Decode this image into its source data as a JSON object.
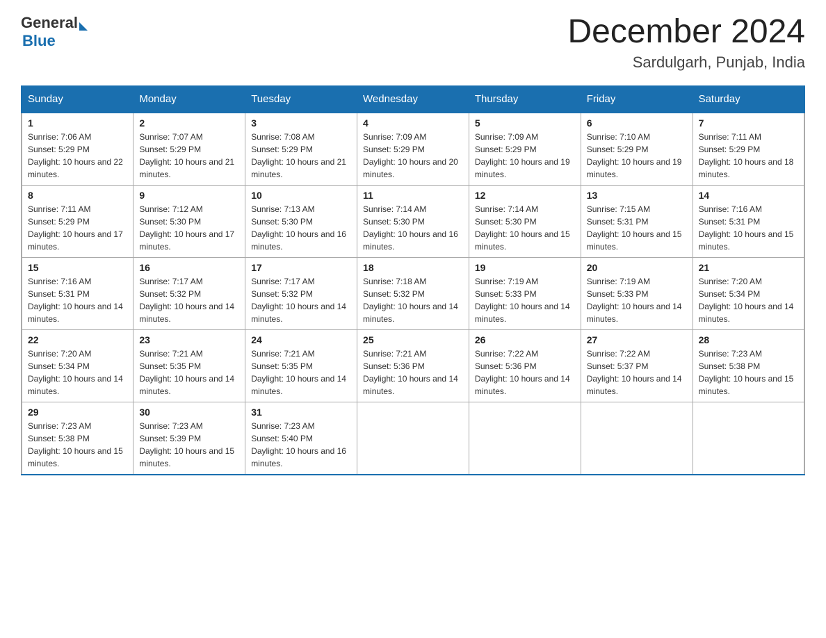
{
  "header": {
    "logo_general": "General",
    "logo_blue": "Blue",
    "title": "December 2024",
    "subtitle": "Sardulgarh, Punjab, India"
  },
  "days_of_week": [
    "Sunday",
    "Monday",
    "Tuesday",
    "Wednesday",
    "Thursday",
    "Friday",
    "Saturday"
  ],
  "weeks": [
    [
      {
        "day": "1",
        "sunrise": "7:06 AM",
        "sunset": "5:29 PM",
        "daylight": "10 hours and 22 minutes."
      },
      {
        "day": "2",
        "sunrise": "7:07 AM",
        "sunset": "5:29 PM",
        "daylight": "10 hours and 21 minutes."
      },
      {
        "day": "3",
        "sunrise": "7:08 AM",
        "sunset": "5:29 PM",
        "daylight": "10 hours and 21 minutes."
      },
      {
        "day": "4",
        "sunrise": "7:09 AM",
        "sunset": "5:29 PM",
        "daylight": "10 hours and 20 minutes."
      },
      {
        "day": "5",
        "sunrise": "7:09 AM",
        "sunset": "5:29 PM",
        "daylight": "10 hours and 19 minutes."
      },
      {
        "day": "6",
        "sunrise": "7:10 AM",
        "sunset": "5:29 PM",
        "daylight": "10 hours and 19 minutes."
      },
      {
        "day": "7",
        "sunrise": "7:11 AM",
        "sunset": "5:29 PM",
        "daylight": "10 hours and 18 minutes."
      }
    ],
    [
      {
        "day": "8",
        "sunrise": "7:11 AM",
        "sunset": "5:29 PM",
        "daylight": "10 hours and 17 minutes."
      },
      {
        "day": "9",
        "sunrise": "7:12 AM",
        "sunset": "5:30 PM",
        "daylight": "10 hours and 17 minutes."
      },
      {
        "day": "10",
        "sunrise": "7:13 AM",
        "sunset": "5:30 PM",
        "daylight": "10 hours and 16 minutes."
      },
      {
        "day": "11",
        "sunrise": "7:14 AM",
        "sunset": "5:30 PM",
        "daylight": "10 hours and 16 minutes."
      },
      {
        "day": "12",
        "sunrise": "7:14 AM",
        "sunset": "5:30 PM",
        "daylight": "10 hours and 15 minutes."
      },
      {
        "day": "13",
        "sunrise": "7:15 AM",
        "sunset": "5:31 PM",
        "daylight": "10 hours and 15 minutes."
      },
      {
        "day": "14",
        "sunrise": "7:16 AM",
        "sunset": "5:31 PM",
        "daylight": "10 hours and 15 minutes."
      }
    ],
    [
      {
        "day": "15",
        "sunrise": "7:16 AM",
        "sunset": "5:31 PM",
        "daylight": "10 hours and 14 minutes."
      },
      {
        "day": "16",
        "sunrise": "7:17 AM",
        "sunset": "5:32 PM",
        "daylight": "10 hours and 14 minutes."
      },
      {
        "day": "17",
        "sunrise": "7:17 AM",
        "sunset": "5:32 PM",
        "daylight": "10 hours and 14 minutes."
      },
      {
        "day": "18",
        "sunrise": "7:18 AM",
        "sunset": "5:32 PM",
        "daylight": "10 hours and 14 minutes."
      },
      {
        "day": "19",
        "sunrise": "7:19 AM",
        "sunset": "5:33 PM",
        "daylight": "10 hours and 14 minutes."
      },
      {
        "day": "20",
        "sunrise": "7:19 AM",
        "sunset": "5:33 PM",
        "daylight": "10 hours and 14 minutes."
      },
      {
        "day": "21",
        "sunrise": "7:20 AM",
        "sunset": "5:34 PM",
        "daylight": "10 hours and 14 minutes."
      }
    ],
    [
      {
        "day": "22",
        "sunrise": "7:20 AM",
        "sunset": "5:34 PM",
        "daylight": "10 hours and 14 minutes."
      },
      {
        "day": "23",
        "sunrise": "7:21 AM",
        "sunset": "5:35 PM",
        "daylight": "10 hours and 14 minutes."
      },
      {
        "day": "24",
        "sunrise": "7:21 AM",
        "sunset": "5:35 PM",
        "daylight": "10 hours and 14 minutes."
      },
      {
        "day": "25",
        "sunrise": "7:21 AM",
        "sunset": "5:36 PM",
        "daylight": "10 hours and 14 minutes."
      },
      {
        "day": "26",
        "sunrise": "7:22 AM",
        "sunset": "5:36 PM",
        "daylight": "10 hours and 14 minutes."
      },
      {
        "day": "27",
        "sunrise": "7:22 AM",
        "sunset": "5:37 PM",
        "daylight": "10 hours and 14 minutes."
      },
      {
        "day": "28",
        "sunrise": "7:23 AM",
        "sunset": "5:38 PM",
        "daylight": "10 hours and 15 minutes."
      }
    ],
    [
      {
        "day": "29",
        "sunrise": "7:23 AM",
        "sunset": "5:38 PM",
        "daylight": "10 hours and 15 minutes."
      },
      {
        "day": "30",
        "sunrise": "7:23 AM",
        "sunset": "5:39 PM",
        "daylight": "10 hours and 15 minutes."
      },
      {
        "day": "31",
        "sunrise": "7:23 AM",
        "sunset": "5:40 PM",
        "daylight": "10 hours and 16 minutes."
      },
      null,
      null,
      null,
      null
    ]
  ],
  "labels": {
    "sunrise": "Sunrise: ",
    "sunset": "Sunset: ",
    "daylight": "Daylight: "
  }
}
